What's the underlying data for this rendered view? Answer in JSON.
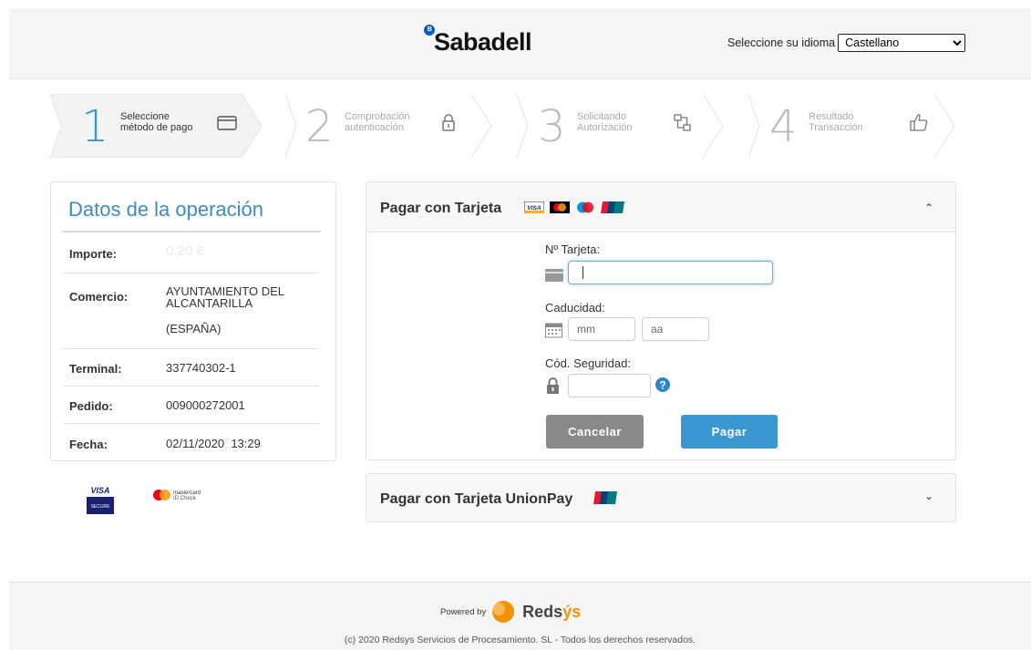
{
  "header": {
    "logo_text": "Sabadell",
    "logo_badge": "B",
    "language_label": "Seleccione su idioma",
    "language_selected": "Castellano",
    "language_options": [
      "Castellano"
    ]
  },
  "steps": [
    {
      "number": "1",
      "line1": "Seleccione",
      "line2": "método de pago",
      "icon": "credit-card-icon",
      "active": true
    },
    {
      "number": "2",
      "line1": "Comprobación",
      "line2": "autenticación",
      "icon": "lock-icon",
      "active": false
    },
    {
      "number": "3",
      "line1": "Solicitando",
      "line2": "Autorización",
      "icon": "network-icon",
      "active": false
    },
    {
      "number": "4",
      "line1": "Resultado",
      "line2": "Transacción",
      "icon": "thumbs-up-icon",
      "active": false
    }
  ],
  "datos": {
    "title": "Datos de la operación",
    "rows": [
      {
        "key": "Importe:",
        "value": "0,20 €"
      },
      {
        "key": "Comercio:",
        "value_line1": "AYUNTAMIENTO DEL",
        "value_line2": "ALCANTARILLA",
        "value_line3": "(ESPAÑA)"
      },
      {
        "key": "Terminal:",
        "value": "337740302-1"
      },
      {
        "key": "Pedido:",
        "value": "009000272001"
      },
      {
        "key": "Fecha:",
        "value": "02/11/2020  13:29"
      }
    ]
  },
  "security_badges": {
    "visa_line1": "VISA",
    "visa_line2": "SECURE",
    "mc_line1": "mastercard",
    "mc_line2": "ID Check"
  },
  "card_panel": {
    "title": "Pagar con Tarjeta",
    "card_logos": [
      "VISA",
      "Mastercard",
      "Maestro",
      "UnionPay"
    ],
    "card_number_label": "Nº Tarjeta:",
    "card_number_value": "",
    "expiry_label": "Caducidad:",
    "month_placeholder": "mm",
    "year_placeholder": "aa",
    "cvv_label": "Cód. Seguridad:",
    "cvv_value": "",
    "help_glyph": "?",
    "cancel_label": "Cancelar",
    "pay_label": "Pagar",
    "collapse_glyph": "⌃"
  },
  "unionpay_panel": {
    "title": "Pagar con Tarjeta UnionPay",
    "expand_glyph": "⌄"
  },
  "footer": {
    "powered_by": "Powered by",
    "brand_part1": "Reds",
    "brand_part2": "ý",
    "brand_part3": "s",
    "copyright": "(c) 2020 Redsys Servicios de Procesamiento. SL - Todos los derechos reservados."
  },
  "colors": {
    "accent": "#3d8bc2",
    "step_active": "#3399cc",
    "pay_button": "#3a98d0",
    "cancel_button": "#8a8a8a",
    "brand_orange": "#f39200"
  }
}
